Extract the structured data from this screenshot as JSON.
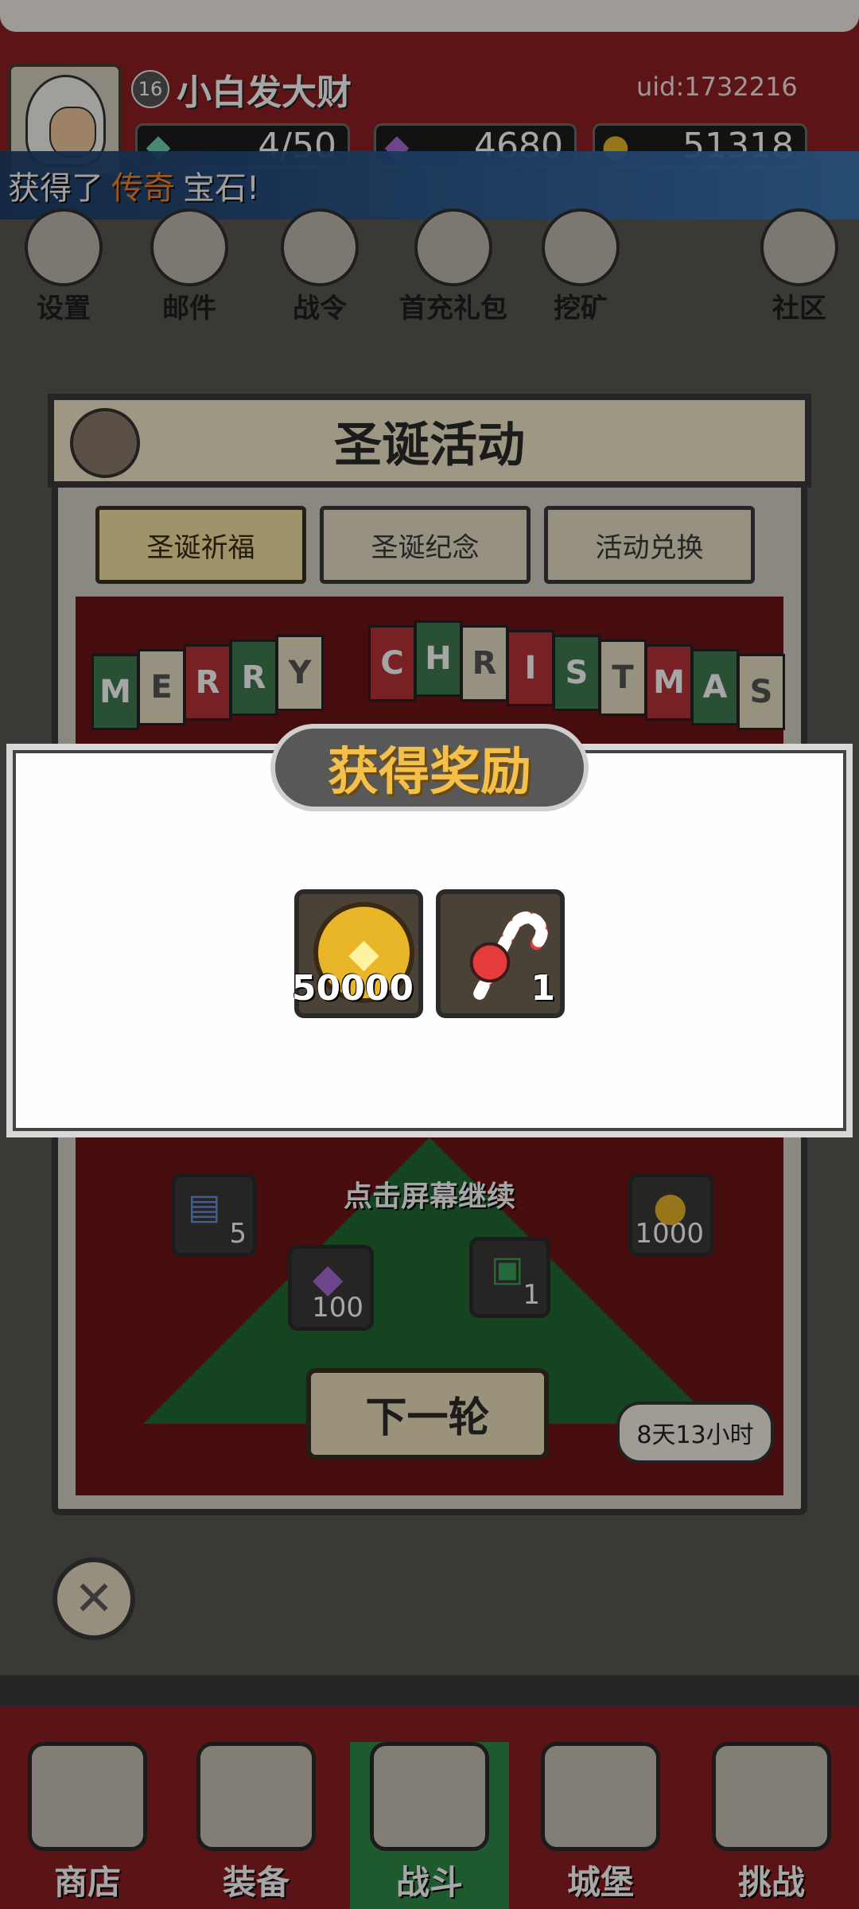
{
  "player": {
    "level": "16",
    "name": "小白发大财",
    "uid": "uid:1732216"
  },
  "resources": [
    {
      "icon": "green-gem-icon",
      "value": "4/50"
    },
    {
      "icon": "purple-diamond-icon",
      "value": "4680"
    },
    {
      "icon": "gold-coin-icon",
      "value": "51318"
    }
  ],
  "banner": {
    "prefix": "获得了",
    "highlight": "传奇",
    "suffix": "宝石!"
  },
  "top_icons": [
    {
      "label": "设置",
      "icon": "gear-icon"
    },
    {
      "label": "邮件",
      "icon": "mail-icon"
    },
    {
      "label": "战令",
      "icon": "battle-pass-icon"
    },
    {
      "label": "首充礼包",
      "icon": "gift-bag-icon"
    },
    {
      "label": "挖矿",
      "icon": "mining-icon"
    },
    {
      "label": "社区",
      "icon": "home-icon"
    }
  ],
  "event": {
    "title": "圣诞活动",
    "tabs": [
      "圣诞祈福",
      "圣诞纪念",
      "活动兑换"
    ],
    "banner_text": "MERRY CHRISTMAS",
    "pool_items": [
      {
        "icon": "spell-book-icon",
        "value": "5"
      },
      {
        "icon": "purple-diamond-icon",
        "value": "100"
      },
      {
        "icon": "gift-box-icon",
        "value": "1"
      },
      {
        "icon": "gold-coin-icon",
        "value": "1000"
      }
    ],
    "tap_hint": "点击屏幕继续",
    "next_round": "下一轮",
    "timer": "8天13小时"
  },
  "reward_modal": {
    "title": "获得奖励",
    "rewards": [
      {
        "icon": "gold-coin-icon",
        "value": "50000"
      },
      {
        "icon": "candy-cane-icon",
        "value": "1"
      }
    ]
  },
  "bottom_nav": [
    {
      "label": "商店",
      "icon": "shop-icon"
    },
    {
      "label": "装备",
      "icon": "backpack-icon"
    },
    {
      "label": "战斗",
      "icon": "crossed-swords-icon"
    },
    {
      "label": "城堡",
      "icon": "castle-icon"
    },
    {
      "label": "挑战",
      "icon": "shield-icon"
    }
  ],
  "colors": {
    "accent_red": "#8c1f22",
    "gold": "#e9b62a",
    "highlight_orange": "#ff8a2a",
    "active_tab_green": "#2e8a46"
  }
}
